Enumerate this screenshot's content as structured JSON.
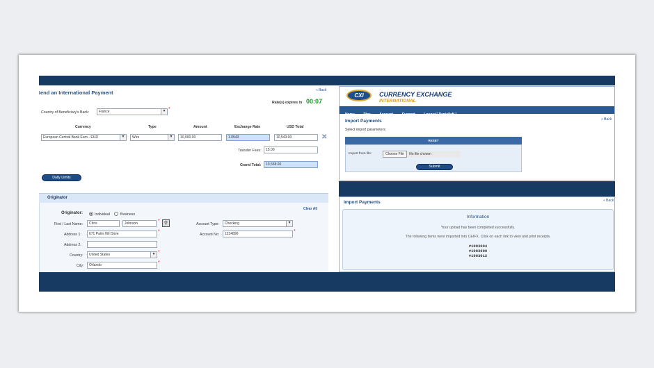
{
  "send_payment": {
    "title": "Send an International Payment",
    "back": "« Back",
    "rate_label": "Rate(s) expires in",
    "rate_timer": "00:07",
    "country_label": "Country of Beneficiary's Bank:",
    "country_value": "France",
    "headers": [
      "Currency",
      "Type",
      "Amount",
      "Exchange Rate",
      "USD Total"
    ],
    "currency": "European Central Bank Euro - EUR",
    "type": "Wire",
    "amount": "10,000.00",
    "exchange_rate": "1.0543",
    "usd_total": "10,543.00",
    "transfer_fees_label": "Transfer Fees:",
    "transfer_fees": "15.00",
    "grand_total_label": "Grand Total:",
    "grand_total": "10,558.00",
    "daily_limits": "Daily Limits",
    "remove_icon": "x-icon"
  },
  "originator": {
    "section_title": "Originator",
    "clear_all": "Clear All",
    "originator_label": "Originator:",
    "option_individual": "Individual",
    "option_business": "Business",
    "name_label": "First / Last Name:",
    "first_name": "Chris",
    "last_name": "Johnson",
    "address1_label": "Address 1:",
    "address1": "671 Palm Hill Drive",
    "address2_label": "Address 2:",
    "address2": "",
    "country_label": "Country:",
    "country": "United States",
    "city_label": "City:",
    "city": "Orlando",
    "account_type_label": "Account Type:",
    "account_type": "Checking",
    "account_no_label": "Account No:",
    "account_no": "1234890"
  },
  "cxi": {
    "logo": "CXI",
    "brand_line1": "CURRENCY EXCHANGE",
    "brand_line2": "INTERNATIONAL",
    "nav": [
      "Home",
      "Pics",
      "Account",
      "Support",
      "Logout [ Danielleft ]"
    ],
    "import_title": "Import Payments",
    "back": "« Back",
    "subtitle": "Select import parameters",
    "reset": "RESET",
    "import_label": "Import from file:",
    "choose_file": "Choose File",
    "no_file": "No file chosen",
    "submit": "Submit"
  },
  "import_result": {
    "title": "Import Payments",
    "back": "« Back",
    "info_title": "Information",
    "line1": "Your upload has been completed successfully.",
    "line2": "The following items were imported into CEIFX. Click on each link to view and print receipts.",
    "items": [
      "#1083004",
      "#1083008",
      "#1083012"
    ]
  }
}
